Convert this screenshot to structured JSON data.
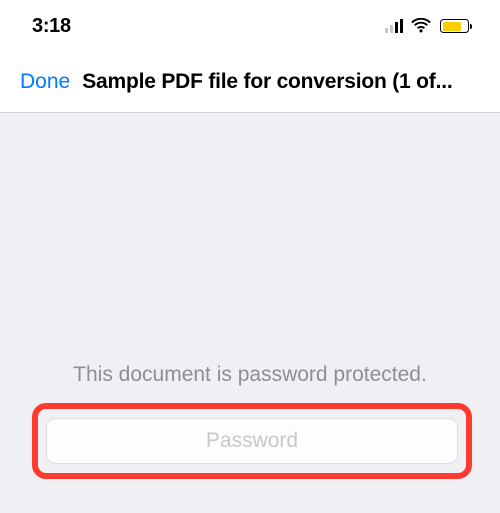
{
  "status_bar": {
    "time": "3:18",
    "signal_active_bars": 2,
    "signal_total_bars": 4,
    "wifi_full": true,
    "battery_percent": 75,
    "battery_color": "#ffcc00"
  },
  "nav": {
    "done_label": "Done",
    "title": "Sample PDF file for conversion  (1 of..."
  },
  "prompt": {
    "message": "This document is password protected.",
    "placeholder": "Password"
  },
  "highlight": {
    "color": "#ff3b30"
  }
}
